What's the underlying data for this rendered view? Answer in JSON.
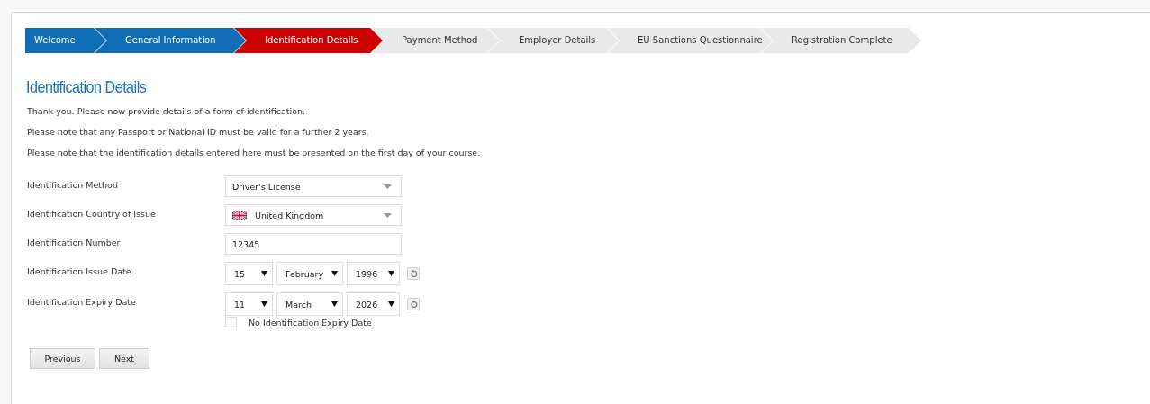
{
  "steps": [
    {
      "label": "Welcome",
      "completed": true,
      "selected": false
    },
    {
      "label": "General Information",
      "completed": true,
      "selected": false
    },
    {
      "label": "Identification Details",
      "completed": false,
      "selected": true
    },
    {
      "label": "Payment Method",
      "completed": false,
      "selected": false
    },
    {
      "label": "Employer Details",
      "completed": false,
      "selected": false
    },
    {
      "label": "EU Sanctions Questionnaire",
      "completed": false,
      "selected": false
    },
    {
      "label": "Registration Complete",
      "completed": false,
      "selected": false
    }
  ],
  "heading": "Identification Details",
  "paragraphs": [
    "Thank you. Please now provide details of a form of identification.",
    "Please note that any Passport or National ID must be valid for a further 2 years.",
    "Please note that the identification details entered here must be presented on the first day of your course."
  ],
  "fields": [
    {
      "kind": "select",
      "label": "Identification Method",
      "value": "Driver's License"
    },
    {
      "kind": "country",
      "label": "Identification Country of Issue",
      "value": "United Kingdom"
    },
    {
      "kind": "text",
      "label": "Identification Number",
      "value": "12345"
    },
    {
      "kind": "date",
      "label": "Identification Issue Date",
      "day": "15",
      "month": "February",
      "year": "1996"
    },
    {
      "kind": "date",
      "label": "Identification Expiry Date",
      "day": "11",
      "month": "March",
      "year": "2026",
      "checkbox": {
        "label": "No Identification Expiry Date",
        "checked": false
      }
    }
  ],
  "buttons": [
    "Previous",
    "Next"
  ]
}
